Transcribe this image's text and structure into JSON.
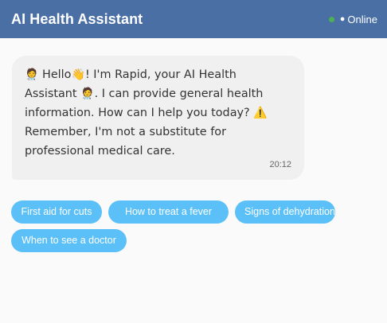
{
  "header": {
    "title": "AI Health Assistant",
    "status_label": "Online",
    "status_color": "#4caf50",
    "background_color": "#4a6fa5"
  },
  "message": {
    "emoji_leading": "🧑‍⚕️",
    "text_line_1": " Hello",
    "emoji_wave": "👋",
    "text_line_2": "! I'm Rapid, your AI Health Assistant ",
    "emoji_doctor": "🧑‍⚕️",
    "text_line_3": ". I can provide general health information. How can I help you today? ",
    "emoji_warning": "⚠️",
    "text_line_4": "\nRemember, I'm not a substitute for professional medical care.",
    "timestamp": "20:12"
  },
  "quick_replies": {
    "accent_color": "#5bc0f8",
    "items": [
      {
        "label": "First aid for cuts"
      },
      {
        "label": "How to treat a fever"
      },
      {
        "label": "Signs of dehydration"
      },
      {
        "label": "When to see a doctor"
      }
    ]
  }
}
